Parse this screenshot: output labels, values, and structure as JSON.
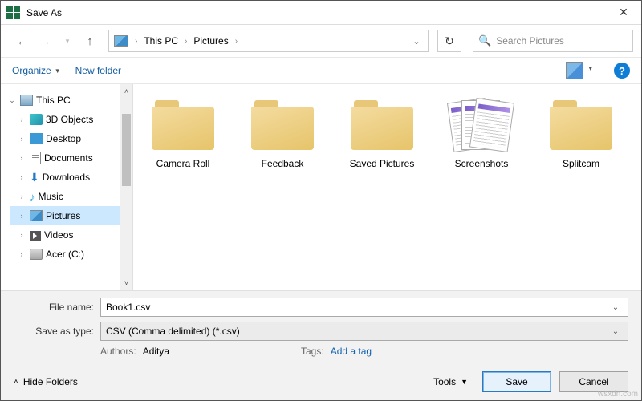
{
  "title": "Save As",
  "nav": {
    "crumbs": [
      "This PC",
      "Pictures"
    ],
    "search_placeholder": "Search Pictures"
  },
  "toolbar": {
    "organize": "Organize",
    "new_folder": "New folder"
  },
  "tree": {
    "root": "This PC",
    "items": [
      {
        "label": "3D Objects"
      },
      {
        "label": "Desktop"
      },
      {
        "label": "Documents"
      },
      {
        "label": "Downloads"
      },
      {
        "label": "Music"
      },
      {
        "label": "Pictures",
        "selected": true
      },
      {
        "label": "Videos"
      },
      {
        "label": "Acer (C:)"
      }
    ]
  },
  "content": [
    {
      "name": "Camera Roll",
      "type": "folder"
    },
    {
      "name": "Feedback",
      "type": "folder"
    },
    {
      "name": "Saved Pictures",
      "type": "folder"
    },
    {
      "name": "Screenshots",
      "type": "shots"
    },
    {
      "name": "Splitcam",
      "type": "folder"
    }
  ],
  "form": {
    "file_name_label": "File name:",
    "file_name_value": "Book1.csv",
    "save_type_label": "Save as type:",
    "save_type_value": "CSV (Comma delimited) (*.csv)",
    "authors_label": "Authors:",
    "authors_value": "Aditya",
    "tags_label": "Tags:",
    "tags_value": "Add a tag"
  },
  "footer": {
    "hide_folders": "Hide Folders",
    "tools": "Tools",
    "save": "Save",
    "cancel": "Cancel"
  },
  "watermark": "wsxdn.com"
}
